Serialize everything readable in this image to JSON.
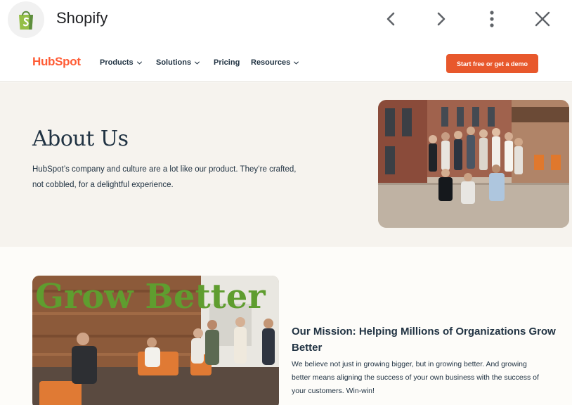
{
  "appbar": {
    "title": "Shopify",
    "back_label": "Back",
    "forward_label": "Forward",
    "more_label": "More",
    "close_label": "Close"
  },
  "header": {
    "logo_text": "HubSpot",
    "menu": [
      {
        "label": "Products",
        "has_dropdown": true
      },
      {
        "label": "Solutions",
        "has_dropdown": true
      },
      {
        "label": "Pricing",
        "has_dropdown": false
      },
      {
        "label": "Resources",
        "has_dropdown": true
      }
    ],
    "cta_label": "Start free or get a demo"
  },
  "about": {
    "title": "About Us",
    "text": "HubSpot’s company and culture are a lot like our product. They’re crafted, not cobbled, for a delightful experience."
  },
  "mission": {
    "wall_sign": "Grow Better",
    "title": "Our Mission: Helping Millions of Organizations Grow Better",
    "text": "We believe not just in growing bigger, but in growing better. And growing better means aligning the success of your own business with the success of your customers. Win-win!"
  },
  "colors": {
    "brand_orange": "#ff5c35",
    "cta_orange": "#e8582c",
    "navy_text": "#213343",
    "about_bg": "#f6f3ee",
    "shopify_green": "#95bf47"
  }
}
